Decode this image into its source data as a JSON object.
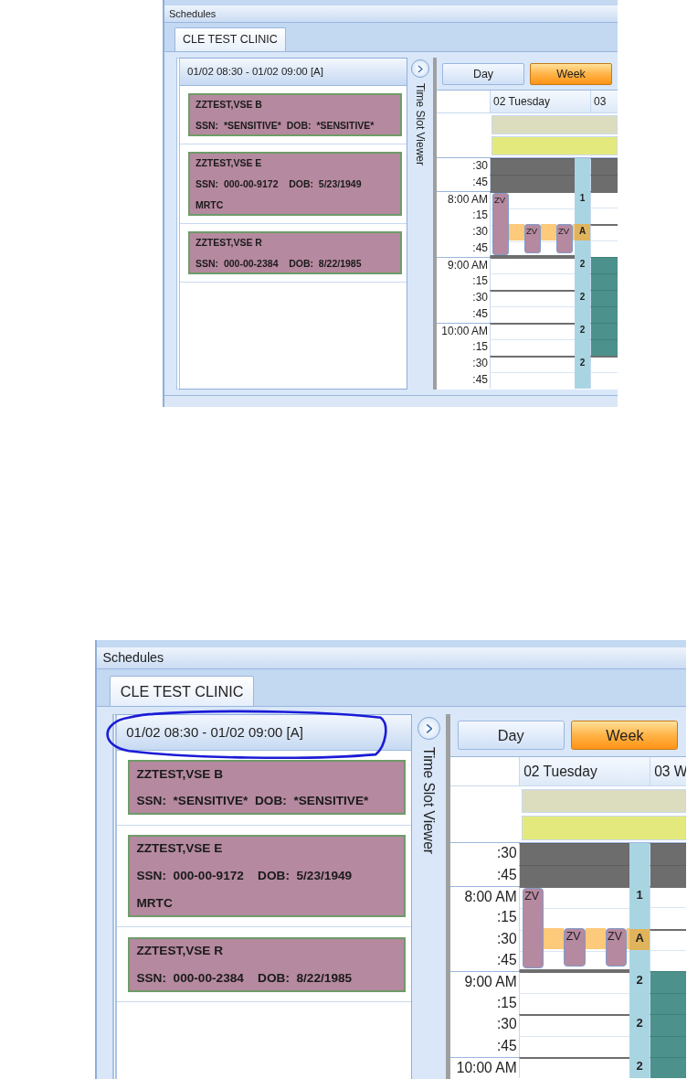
{
  "screenshots": [
    {
      "window_title": "Schedules",
      "tabs": [
        {
          "label": "CLE TEST CLINIC",
          "selected": true
        }
      ],
      "slot_header": {
        "text": "01/02 08:30 - 01/02 09:00 [A]",
        "circled": false
      },
      "patients": [
        {
          "name": "ZZTEST,VSE B",
          "lines": [
            "SSN:  *SENSITIVE*  DOB:  *SENSITIVE*"
          ]
        },
        {
          "name": "ZZTEST,VSE E",
          "lines": [
            "SSN:  000-00-9172    DOB:  5/23/1949",
            "MRTC"
          ]
        },
        {
          "name": "ZZTEST,VSE R",
          "lines": [
            "SSN:  000-00-2384    DOB:  8/22/1985"
          ]
        }
      ],
      "side_panel": {
        "label": "Time Slot Viewer"
      },
      "view_buttons": [
        {
          "label": "Day",
          "selected": false
        },
        {
          "label": "Week",
          "selected": true
        }
      ],
      "day_headers": [
        "02 Tuesday",
        "03"
      ],
      "time_rows": [
        {
          "label": ":30",
          "hour": false,
          "held": false,
          "blocked": true,
          "booked": false
        },
        {
          "label": ":45",
          "hour": false,
          "held": false,
          "blocked": true,
          "booked": false
        },
        {
          "label": "8:00 AM",
          "hour": true,
          "held": false,
          "blocked": false,
          "booked": false,
          "strip": "1",
          "appointments": [
            "ZV"
          ]
        },
        {
          "label": ":15",
          "hour": false,
          "held": false,
          "blocked": false,
          "booked": false
        },
        {
          "label": ":30",
          "hour": false,
          "held": true,
          "blocked": false,
          "booked": false,
          "strip": "A",
          "appointments": [
            "ZV",
            "ZV"
          ]
        },
        {
          "label": ":45",
          "hour": false,
          "held": false,
          "blocked": false,
          "booked": false
        },
        {
          "label": "9:00 AM",
          "hour": true,
          "held": false,
          "blocked": false,
          "booked": true,
          "strip": "2"
        },
        {
          "label": ":15",
          "hour": false,
          "held": false,
          "blocked": false,
          "booked": true
        },
        {
          "label": ":30",
          "hour": false,
          "held": false,
          "blocked": false,
          "booked": true,
          "strip": "2"
        },
        {
          "label": ":45",
          "hour": false,
          "held": false,
          "blocked": false,
          "booked": true
        },
        {
          "label": "10:00 AM",
          "hour": true,
          "held": false,
          "blocked": false,
          "booked": true,
          "strip": "2"
        },
        {
          "label": ":15",
          "hour": false,
          "held": false,
          "blocked": false,
          "booked": true
        },
        {
          "label": ":30",
          "hour": false,
          "held": false,
          "blocked": false,
          "booked": false,
          "strip": "2"
        },
        {
          "label": ":45",
          "hour": false,
          "held": false,
          "blocked": false,
          "booked": false
        }
      ],
      "status_bar": {
        "shown": true
      }
    },
    {
      "window_title": "Schedules",
      "tabs": [
        {
          "label": "CLE TEST CLINIC",
          "selected": true
        }
      ],
      "slot_header": {
        "text": "01/02 08:30 - 01/02 09:00 [A]",
        "circled": true
      },
      "patients": [
        {
          "name": "ZZTEST,VSE B",
          "lines": [
            "SSN:  *SENSITIVE*  DOB:  *SENSITIVE*"
          ]
        },
        {
          "name": "ZZTEST,VSE E",
          "lines": [
            "SSN:  000-00-9172    DOB:  5/23/1949",
            "MRTC"
          ]
        },
        {
          "name": "ZZTEST,VSE R",
          "lines": [
            "SSN:  000-00-2384    DOB:  8/22/1985"
          ]
        }
      ],
      "side_panel": {
        "label": "Time Slot Viewer"
      },
      "view_buttons": [
        {
          "label": "Day",
          "selected": false
        },
        {
          "label": "Week",
          "selected": true
        }
      ],
      "day_headers": [
        "02 Tuesday",
        "03 W"
      ],
      "time_rows": [
        {
          "label": ":30",
          "hour": false,
          "held": false,
          "blocked": true,
          "booked": false
        },
        {
          "label": ":45",
          "hour": false,
          "held": false,
          "blocked": true,
          "booked": false
        },
        {
          "label": "8:00 AM",
          "hour": true,
          "held": false,
          "blocked": false,
          "booked": false,
          "strip": "1",
          "appointments": [
            "ZV"
          ]
        },
        {
          "label": ":15",
          "hour": false,
          "held": false,
          "blocked": false,
          "booked": false
        },
        {
          "label": ":30",
          "hour": false,
          "held": true,
          "blocked": false,
          "booked": false,
          "strip": "A",
          "appointments": [
            "ZV",
            "ZV"
          ]
        },
        {
          "label": ":45",
          "hour": false,
          "held": false,
          "blocked": false,
          "booked": false
        },
        {
          "label": "9:00 AM",
          "hour": true,
          "held": false,
          "blocked": false,
          "booked": true,
          "strip": "2"
        },
        {
          "label": ":15",
          "hour": false,
          "held": false,
          "blocked": false,
          "booked": true
        },
        {
          "label": ":30",
          "hour": false,
          "held": false,
          "blocked": false,
          "booked": true,
          "strip": "2"
        },
        {
          "label": ":45",
          "hour": false,
          "held": false,
          "blocked": false,
          "booked": true
        },
        {
          "label": "10:00 AM",
          "hour": true,
          "held": false,
          "blocked": false,
          "booked": true,
          "strip": "2"
        }
      ]
    }
  ]
}
